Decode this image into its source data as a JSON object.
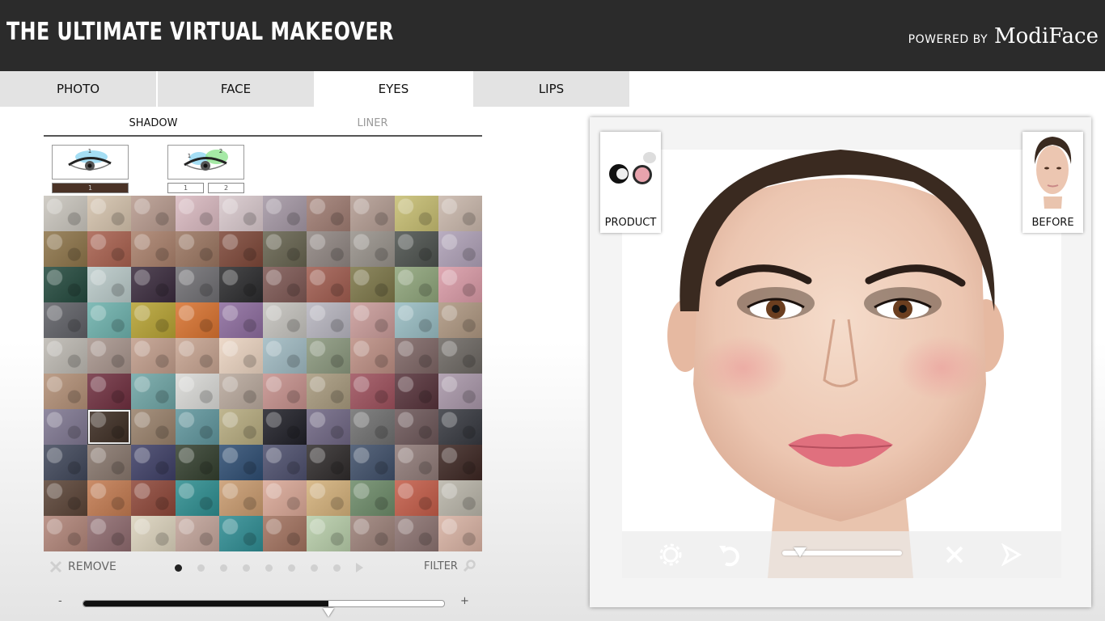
{
  "header": {
    "title": "THE ULTIMATE VIRTUAL MAKEOVER",
    "powered_by": "POWERED BY",
    "brand": "ModiFace"
  },
  "tabs": [
    {
      "label": "PHOTO",
      "active": false
    },
    {
      "label": "FACE",
      "active": false
    },
    {
      "label": "EYES",
      "active": true
    },
    {
      "label": "LIPS",
      "active": false
    }
  ],
  "subtabs": [
    {
      "label": "SHADOW",
      "active": true
    },
    {
      "label": "LINER",
      "active": false
    }
  ],
  "shadow_styles": [
    {
      "slots": [
        "1"
      ],
      "number_labels": [
        "1"
      ]
    },
    {
      "slots": [
        "1",
        "2"
      ],
      "number_labels": [
        "1",
        "2"
      ]
    }
  ],
  "palette": {
    "selected_index": 61,
    "colors": [
      "#c9c5bd",
      "#d4c2ac",
      "#b79a8e",
      "#d9b9c0",
      "#d8c8cc",
      "#a497a4",
      "#9f7c72",
      "#b39c92",
      "#c6bd71",
      "#c9b7ab",
      "#8d7449",
      "#a8604e",
      "#a9806b",
      "#9a7560",
      "#7d4738",
      "#66634f",
      "#8f8581",
      "#97918a",
      "#4c514d",
      "#aea0b6",
      "#23493d",
      "#b9c9c8",
      "#3a2b3d",
      "#6f6e72",
      "#2b2b2d",
      "#7d5753",
      "#a05c4f",
      "#7c7648",
      "#8ea47a",
      "#d99aa6",
      "#5f6066",
      "#6db1ac",
      "#b6a233",
      "#d8722f",
      "#8c6b9d",
      "#c4c2bd",
      "#b7b5bf",
      "#c99b99",
      "#98bcc2",
      "#ad9680",
      "#bcb8b1",
      "#a7948c",
      "#c19d8b",
      "#c6a390",
      "#ead3c0",
      "#9fb9c1",
      "#8a977d",
      "#bc8e83",
      "#7d6564",
      "#6c6762",
      "#b28f76",
      "#6f2f3f",
      "#6fa5a5",
      "#d9d9d6",
      "#b8a89c",
      "#c5908c",
      "#a7997d",
      "#9d505c",
      "#56323a",
      "#a896a8",
      "#7e7690",
      "#3c2c22",
      "#98806a",
      "#5f959c",
      "#b5aa7e",
      "#1f1f27",
      "#6f6683",
      "#6f6f6f",
      "#6c5658",
      "#36383f",
      "#40475a",
      "#87766c",
      "#3e3f66",
      "#333f2e",
      "#2e4d72",
      "#4d4f6d",
      "#2f2b2b",
      "#3f4f69",
      "#8f7a77",
      "#3c2622",
      "#5a4336",
      "#c27a50",
      "#8d4638",
      "#2d8d8f",
      "#c89a6e",
      "#d9a796",
      "#d3b07a",
      "#6c8a68",
      "#c35c48",
      "#b8b4a8",
      "#b08478",
      "#8e6a6e",
      "#dbd2bc",
      "#c2a49a",
      "#2e8c92",
      "#a1715e",
      "#b7cda9",
      "#9b8078",
      "#8b7270",
      "#d7b1a2"
    ]
  },
  "controls": {
    "remove_label": "REMOVE",
    "filter_label": "FILTER",
    "pages": 8,
    "current_page": 0,
    "intensity_minus": "-",
    "intensity_plus": "+",
    "intensity_value": 0.68
  },
  "viewer": {
    "product_label": "PRODUCT",
    "before_label": "BEFORE",
    "zoom_value": 0.15
  },
  "colors": {
    "header_bg": "#2b2b2b",
    "tab_bg": "#e3e3e3",
    "tab_active_bg": "#ffffff",
    "lip": "#e0707e",
    "blush": "#ec9a9a",
    "eyeshadow": "#3c2c22"
  }
}
